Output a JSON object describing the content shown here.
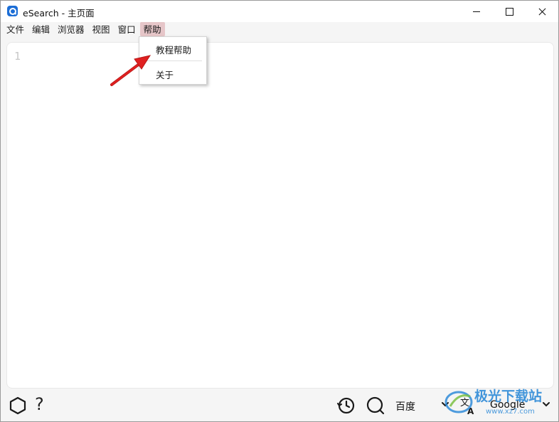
{
  "window": {
    "title": "eSearch - 主页面"
  },
  "menubar": {
    "items": [
      {
        "label": "文件"
      },
      {
        "label": "编辑"
      },
      {
        "label": "浏览器"
      },
      {
        "label": "视图"
      },
      {
        "label": "窗口"
      },
      {
        "label": "帮助",
        "active": true
      }
    ]
  },
  "help_menu": {
    "items": [
      {
        "label": "教程帮助"
      },
      {
        "label": "关于"
      }
    ]
  },
  "editor": {
    "line_number": "1"
  },
  "bottombar": {
    "search_engine": "百度",
    "translate_engine": "Google"
  },
  "watermark": {
    "text": "极光下载站",
    "url": "www.xz7.com"
  },
  "colors": {
    "app_icon": "#1c6ed6",
    "menu_active_bg": "#e6c6c9",
    "annotation_arrow": "#e02020",
    "watermark": "#2f8bd8"
  }
}
